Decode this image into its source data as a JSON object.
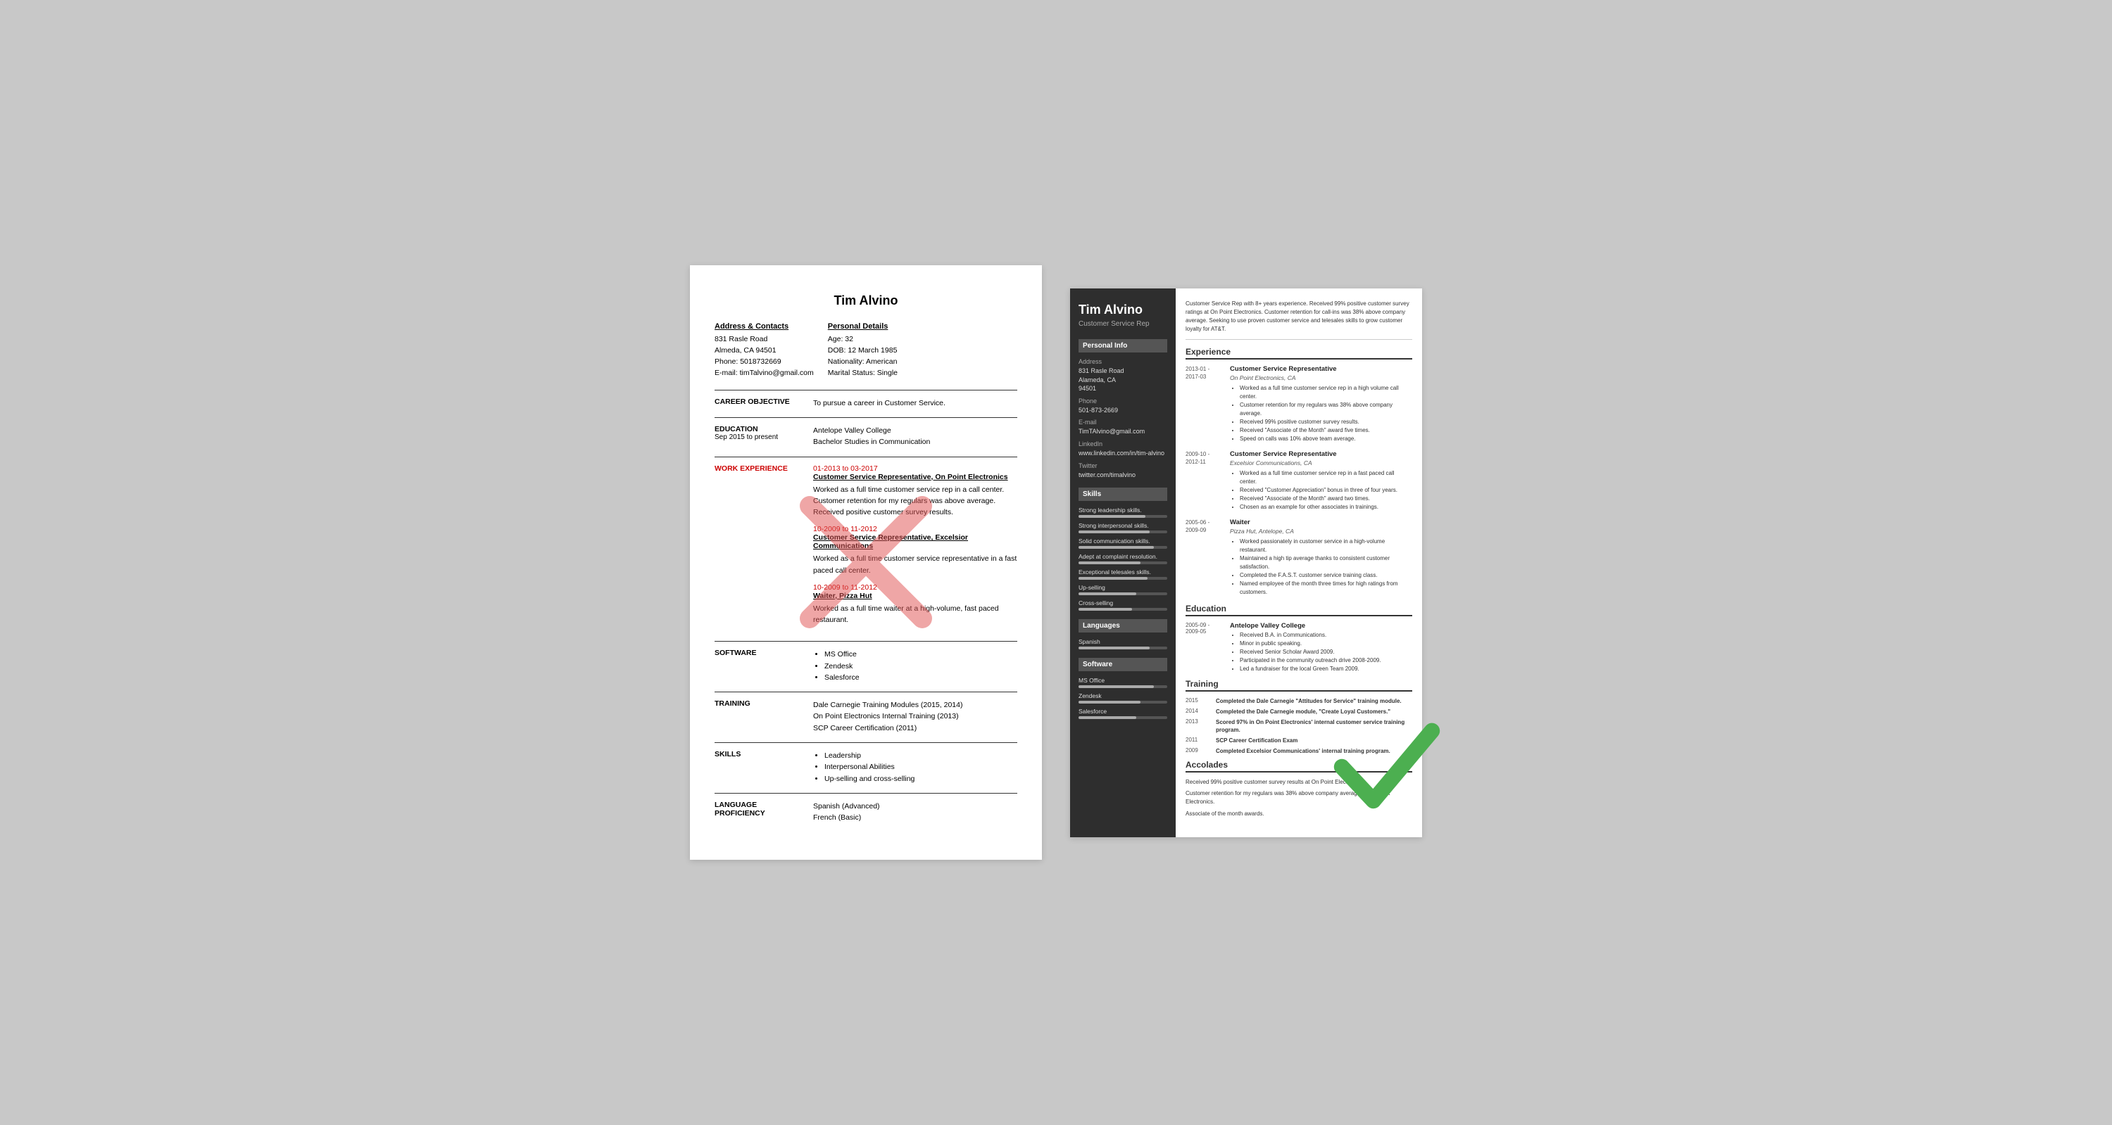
{
  "left": {
    "name": "Tim Alvino",
    "address_label": "Address & Contacts",
    "address": "831 Rasle Road\nAlmeda, CA 94501\nPhone: 5018732669\nE-mail: timTalvino@gmail.com",
    "personal_label": "Personal Details",
    "personal": "Age:  32\nDOB: 12 March 1985\nNationality: American\nMarital Status: Single",
    "objective_label": "CAREER OBJECTIVE",
    "objective": "To pursue a career in Customer Service.",
    "education_label": "EDUCATION",
    "education_date": "Sep 2015 to present",
    "education_school": "Antelope Valley College",
    "education_degree": "Bachelor Studies in Communication",
    "work_label": "WORK EXPERIENCE",
    "jobs": [
      {
        "date": "01-2013 to 03-2017",
        "title": "Customer Service Representative, On Point Electronics",
        "desc": "Worked as a full time customer service rep in a call center. Customer retention for my regulars was above average. Received positive customer survey results."
      },
      {
        "date": "10-2009 to 11-2012",
        "title": "Customer Service Representative, Excelsior Communications",
        "desc": "Worked as a full time customer service representative in a fast paced call center."
      },
      {
        "date": "10-2009 to 11-2012",
        "title": "Waiter, Pizza Hut",
        "desc": "Worked as a full time waiter at a high-volume, fast paced restaurant."
      }
    ],
    "software_label": "SOFTWARE",
    "software": [
      "MS Office",
      "Zendesk",
      "Salesforce"
    ],
    "training_label": "TRAINING",
    "training": "Dale Carnegie Training Modules (2015, 2014)\nOn Point Electronics Internal Training (2013)\nSCP Career Certification (2011)",
    "skills_label": "SKILLS",
    "skills": [
      "Leadership",
      "Interpersonal Abilities",
      "Up-selling and cross-selling"
    ],
    "language_label": "LANGUAGE\nPROFICIENCY",
    "language": "Spanish (Advanced)\nFrench (Basic)"
  },
  "right": {
    "name": "Tim Alvino",
    "title": "Customer Service Rep",
    "summary": "Customer Service Rep with 8+ years experience. Received 99% positive customer survey ratings at On Point Electronics. Customer retention for call-ins was 38% above company average. Seeking to use proven customer service and telesales skills to grow customer loyalty for AT&T.",
    "sidebar": {
      "personal_info_header": "Personal Info",
      "address_label": "Address",
      "address": "831 Rasle Road\nAlameda, CA\n94501",
      "phone_label": "Phone",
      "phone": "501-873-2669",
      "email_label": "E-mail",
      "email": "TimTAlvino@gmail.com",
      "linkedin_label": "LinkedIn",
      "linkedin": "www.linkedin.com/in/tim-alvino",
      "twitter_label": "Twitter",
      "twitter": "twitter.com/timalvino",
      "skills_header": "Skills",
      "skills": [
        {
          "label": "Strong leadership skills.",
          "pct": 75
        },
        {
          "label": "Strong interpersonal skills.",
          "pct": 80
        },
        {
          "label": "Solid communication skills.",
          "pct": 85
        },
        {
          "label": "Adept at complaint resolution.",
          "pct": 70
        },
        {
          "label": "Exceptional telesales skills.",
          "pct": 78
        },
        {
          "label": "Up-selling",
          "pct": 65
        },
        {
          "label": "Cross-selling",
          "pct": 60
        }
      ],
      "languages_header": "Languages",
      "languages": [
        {
          "label": "Spanish",
          "pct": 80
        }
      ],
      "software_header": "Software",
      "software": [
        {
          "label": "MS Office",
          "pct": 85
        },
        {
          "label": "Zendesk",
          "pct": 70
        },
        {
          "label": "Salesforce",
          "pct": 65
        }
      ]
    },
    "experience_header": "Experience",
    "jobs": [
      {
        "date": "2013-01 -\n2017-03",
        "title": "Customer Service Representative",
        "company": "On Point Electronics, CA",
        "bullets": [
          "Worked as a full time customer service rep in a high volume call center.",
          "Customer retention for my regulars was 38% above company average.",
          "Received 99% positive customer survey results.",
          "Received \"Associate of the Month\" award five times.",
          "Speed on calls was 10% above team average."
        ]
      },
      {
        "date": "2009-10 -\n2012-11",
        "title": "Customer Service Representative",
        "company": "Excelsior Communications, CA",
        "bullets": [
          "Worked as a full time customer service rep in a fast paced call center.",
          "Received \"Customer Appreciation\" bonus in three of four years.",
          "Received \"Associate of the Month\" award two times.",
          "Chosen as an example for other associates in trainings."
        ]
      },
      {
        "date": "2005-06 -\n2009-09",
        "title": "Waiter",
        "company": "Pizza Hut, Antelope, CA",
        "bullets": [
          "Worked passionately in customer service in a high-volume restaurant.",
          "Maintained a high tip average thanks to consistent customer satisfaction.",
          "Completed the F.A.S.T. customer service training class.",
          "Named employee of the month three times for high ratings from customers."
        ]
      }
    ],
    "education_header": "Education",
    "education": [
      {
        "date": "2005-09 -\n2009-05",
        "school": "Antelope Valley College",
        "bullets": [
          "Received B.A. in Communications.",
          "Minor in public speaking.",
          "Received Senior Scholar Award 2009.",
          "Participated in the community outreach drive 2008-2009.",
          "Led a fundraiser for the local Green Team 2009."
        ]
      }
    ],
    "training_header": "Training",
    "training": [
      {
        "year": "2015",
        "text": "Completed the Dale Carnegie \"Attitudes for Service\" training module."
      },
      {
        "year": "2014",
        "text": "Completed the Dale Carnegie module, \"Create Loyal Customers.\""
      },
      {
        "year": "2013",
        "text": "Scored 97% in On Point Electronics' internal customer service training program."
      },
      {
        "year": "2011",
        "text": "SCP Career Certification Exam"
      },
      {
        "year": "2009",
        "text": "Completed Excelsior Communications' internal training program."
      }
    ],
    "accolades_header": "Accolades",
    "accolades": [
      "Received 99% positive customer survey results at On Point Electronics.",
      "Customer retention for my regulars was 38% above company average at On Point Electronics.",
      "Associate of the month awards."
    ]
  }
}
